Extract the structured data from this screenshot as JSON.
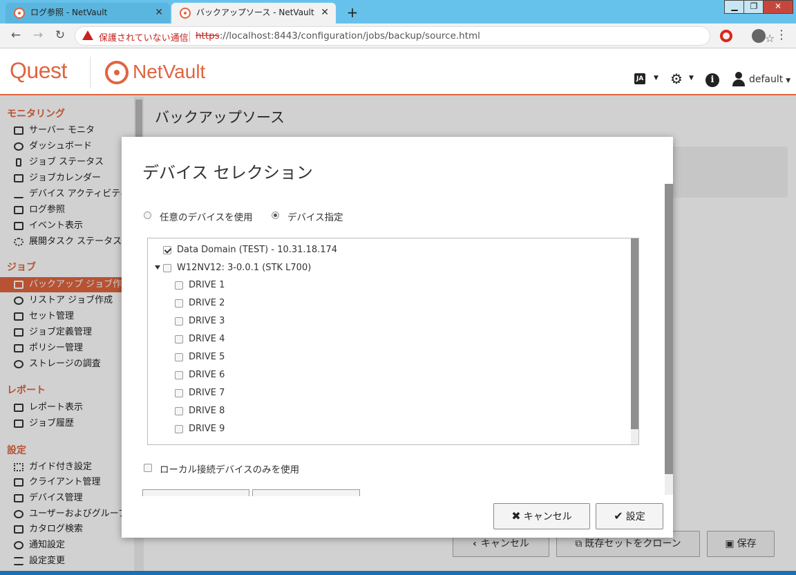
{
  "browser": {
    "tabs": [
      {
        "title": "ログ参照 - NetVault",
        "active": false
      },
      {
        "title": "バックアップソース - NetVault",
        "active": true
      }
    ],
    "insecure_label": "保護されていない通信",
    "url_scheme": "https",
    "url_rest": "://localhost:8443/configuration/jobs/backup/source.html"
  },
  "header": {
    "brand": "Quest",
    "product": "NetVault",
    "lang": "JA",
    "user": "default"
  },
  "sidebar": {
    "sections": [
      {
        "title": "モニタリング",
        "items": [
          "サーバー モニタ",
          "ダッシュボード",
          "ジョブ ステータス",
          "ジョブカレンダー",
          "デバイス アクティビティ",
          "ログ参照",
          "イベント表示",
          "展開タスク ステータス"
        ]
      },
      {
        "title": "ジョブ",
        "items": [
          "バックアップ ジョブ作成",
          "リストア ジョブ作成",
          "セット管理",
          "ジョブ定義管理",
          "ポリシー管理",
          "ストレージの調査"
        ]
      },
      {
        "title": "レポート",
        "items": [
          "レポート表示",
          "ジョブ履歴"
        ]
      },
      {
        "title": "設定",
        "items": [
          "ガイド付き設定",
          "クライアント管理",
          "デバイス管理",
          "ユーザーおよびグループ",
          "カタログ検索",
          "通知設定",
          "設定変更"
        ]
      }
    ],
    "active_item": "バックアップ ジョブ作成"
  },
  "main": {
    "title": "バックアップソース",
    "buttons": {
      "cancel": "キャンセル",
      "clone": "既存セットをクローン",
      "save": "保存"
    }
  },
  "modal": {
    "title": "デバイス セレクション",
    "radio_any": "任意のデバイスを使用",
    "radio_specify": "デバイス指定",
    "selected_radio": "specify",
    "tree": [
      {
        "label": "Data Domain (TEST) - 10.31.18.174",
        "level": 0,
        "checked": true,
        "expandable": false
      },
      {
        "label": "W12NV12: 3-0.0.1 (STK L700)",
        "level": 0,
        "checked": false,
        "expandable": true
      },
      {
        "label": "DRIVE 1",
        "level": 1,
        "checked": false
      },
      {
        "label": "DRIVE 2",
        "level": 1,
        "checked": false
      },
      {
        "label": "DRIVE 3",
        "level": 1,
        "checked": false
      },
      {
        "label": "DRIVE 4",
        "level": 1,
        "checked": false
      },
      {
        "label": "DRIVE 5",
        "level": 1,
        "checked": false
      },
      {
        "label": "DRIVE 6",
        "level": 1,
        "checked": false
      },
      {
        "label": "DRIVE 7",
        "level": 1,
        "checked": false
      },
      {
        "label": "DRIVE 8",
        "level": 1,
        "checked": false
      },
      {
        "label": "DRIVE 9",
        "level": 1,
        "checked": false
      }
    ],
    "local_only_label": "ローカル接続デバイスのみを使用",
    "cancel_label": "キャンセル",
    "set_label": "設定"
  },
  "colors": {
    "accent": "#e0643f",
    "tab_bar": "#67c2eb"
  }
}
